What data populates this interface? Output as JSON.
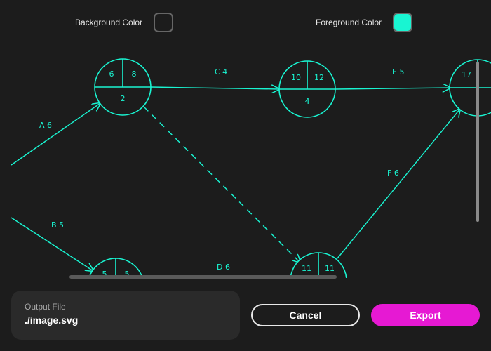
{
  "colors": {
    "background": "#1c1c1c",
    "foreground": "#19f5d2",
    "accent": "#e619d3"
  },
  "settings": {
    "background_label": "Background Color",
    "foreground_label": "Foreground Color"
  },
  "diagram": {
    "nodes": [
      {
        "id": "n1",
        "top_left": "6",
        "top_right": "8",
        "bottom": "2"
      },
      {
        "id": "n2",
        "top_left": "10",
        "top_right": "12",
        "bottom": "4"
      },
      {
        "id": "n3",
        "top_left": "17",
        "top_right": "",
        "bottom": ""
      },
      {
        "id": "n4",
        "top_left": "5",
        "top_right": "5",
        "bottom": ""
      },
      {
        "id": "n5",
        "top_left": "11",
        "top_right": "11",
        "bottom": ""
      }
    ],
    "edges": [
      {
        "from": "",
        "to": "n1",
        "label": "A 6",
        "dashed": false
      },
      {
        "from": "",
        "to": "n4",
        "label": "B 5",
        "dashed": false
      },
      {
        "from": "n1",
        "to": "n2",
        "label": "C 4",
        "dashed": false
      },
      {
        "from": "n4",
        "to": "n5",
        "label": "D 6",
        "dashed": false
      },
      {
        "from": "n2",
        "to": "n3",
        "label": "E 5",
        "dashed": false
      },
      {
        "from": "n5",
        "to": "n3",
        "label": "F 6",
        "dashed": false
      },
      {
        "from": "n1",
        "to": "n5",
        "label": "",
        "dashed": true
      }
    ]
  },
  "output": {
    "caption": "Output File",
    "path": "./image.svg"
  },
  "buttons": {
    "cancel": "Cancel",
    "export": "Export"
  }
}
